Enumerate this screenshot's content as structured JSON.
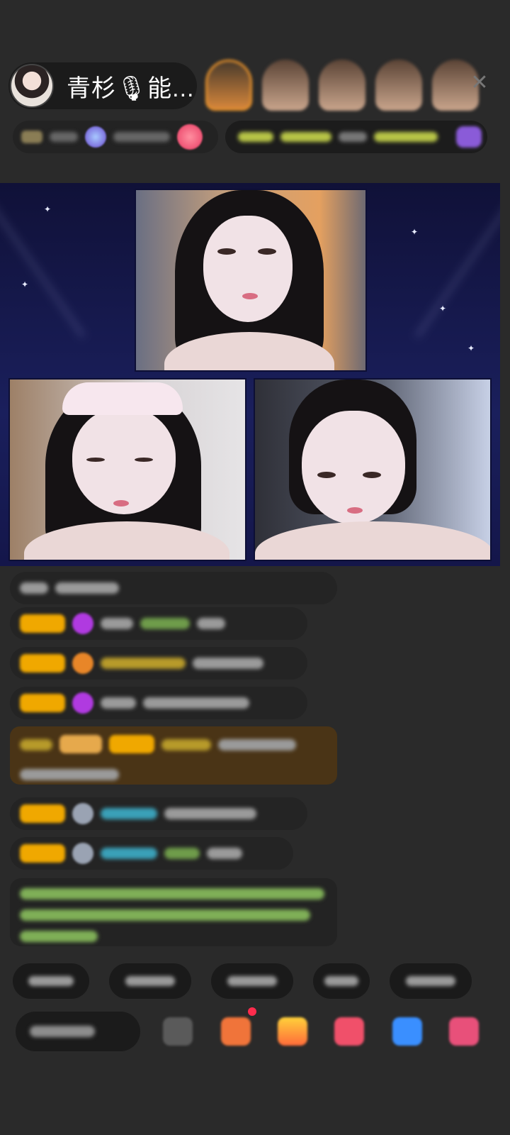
{
  "header": {
    "host_name": "青杉🎙能...",
    "close_icon": "close-icon"
  },
  "viewers": [
    {
      "name": "viewer-avatar-1",
      "highlight": "#e8922b"
    },
    {
      "name": "viewer-avatar-2"
    },
    {
      "name": "viewer-avatar-3"
    },
    {
      "name": "viewer-avatar-4"
    },
    {
      "name": "viewer-avatar-5"
    }
  ],
  "stage": {
    "background": "#1a1f5c",
    "video_tiles": [
      "top-guest",
      "bottom-left-guest",
      "bottom-right-guest"
    ]
  },
  "icons": {
    "close": "close-icon",
    "gift": "gift-icon",
    "emoji": "emoji-icon",
    "more": "more-icon"
  },
  "colors": {
    "badge_yellow": "#f0a800",
    "notification_red": "#ff2c4d"
  }
}
